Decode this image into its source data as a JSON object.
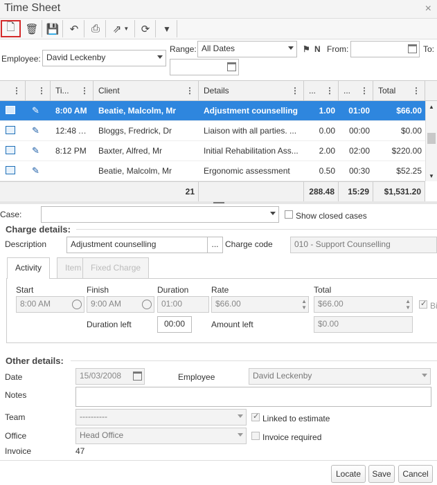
{
  "window": {
    "title": "Time Sheet",
    "close_glyph": "×"
  },
  "toolbar": {
    "buttons": [
      {
        "icon": "new-document-icon",
        "glyph": "🗋"
      },
      {
        "icon": "trash-icon",
        "glyph": "🗑"
      },
      {
        "icon": "save-icon",
        "glyph": "💾"
      },
      {
        "icon": "undo-icon",
        "glyph": "↶"
      },
      {
        "icon": "print-icon",
        "glyph": "⎙"
      },
      {
        "icon": "export-icon",
        "glyph": "⇗"
      },
      {
        "icon": "refresh-icon",
        "glyph": "⟳"
      },
      {
        "icon": "filter-icon",
        "glyph": "▼"
      }
    ]
  },
  "filters": {
    "employee_label": "Employee:",
    "employee_value": "David Leckenby",
    "range_label": "Range:",
    "range_value": "All Dates",
    "from_label": "From:",
    "from_value": "",
    "to_label": "To:",
    "to_value": ""
  },
  "grid": {
    "columns": [
      "",
      "",
      "Ti...",
      "Client",
      "Details",
      "...",
      "...",
      "Total"
    ],
    "rows": [
      {
        "time": "8:00 AM",
        "client": "Beatie, Malcolm, Mr",
        "details": "Adjustment counselling",
        "qty": "1.00",
        "duration": "01:00",
        "total": "$66.00",
        "selected": true
      },
      {
        "time": "12:48 AM",
        "client": "Bloggs, Fredrick, Dr",
        "details": "Liaison with all parties. ...",
        "qty": "0.00",
        "duration": "00:00",
        "total": "$0.00",
        "selected": false
      },
      {
        "time": "8:12 PM",
        "client": "Baxter, Alfred, Mr",
        "details": "Initial Rehabilitation Ass...",
        "qty": "2.00",
        "duration": "02:00",
        "total": "$220.00",
        "selected": false
      },
      {
        "time": "",
        "client": "Beatie, Malcolm, Mr",
        "details": "Ergonomic assessment",
        "qty": "0.50",
        "duration": "00:30",
        "total": "$52.25",
        "selected": false
      }
    ],
    "footer": {
      "count": "21",
      "qty": "288.48",
      "duration": "15:29",
      "total": "$1,531.20"
    }
  },
  "case": {
    "label": "Case:",
    "value": "",
    "show_closed_label": "Show closed cases"
  },
  "charge": {
    "heading": "Charge details:",
    "description_label": "Description",
    "description_value": "Adjustment counselling",
    "ellipsis": "...",
    "charge_code_label": "Charge code",
    "charge_code_value": "010 - Support Counselling",
    "tabs": [
      "Activity",
      "Item",
      "Fixed Charge"
    ],
    "start_label": "Start",
    "start_value": "8:00 AM",
    "finish_label": "Finish",
    "finish_value": "9:00 AM",
    "duration_label": "Duration",
    "duration_value": "01:00",
    "rate_label": "Rate",
    "rate_value": "$66.00",
    "total_label": "Total",
    "total_value": "$66.00",
    "billable_label": "Bi",
    "duration_left_label": "Duration left",
    "duration_left_value": "00:00",
    "amount_left_label": "Amount left",
    "amount_left_value": "$0.00"
  },
  "other": {
    "heading": "Other details:",
    "date_label": "Date",
    "date_value": "15/03/2008",
    "employee_label": "Employee",
    "employee_value": "David Leckenby",
    "notes_label": "Notes",
    "notes_value": "",
    "team_label": "Team",
    "team_value": "----------",
    "linked_label": "Linked to estimate",
    "office_label": "Office",
    "office_value": "Head Office",
    "invoice_required_label": "Invoice required",
    "invoice_label": "Invoice",
    "invoice_value": "47"
  },
  "actions": {
    "locate": "Locate",
    "save": "Save",
    "cancel": "Cancel"
  },
  "colors": {
    "selection": "#2e86de",
    "active_outline": "#d42a2a"
  }
}
